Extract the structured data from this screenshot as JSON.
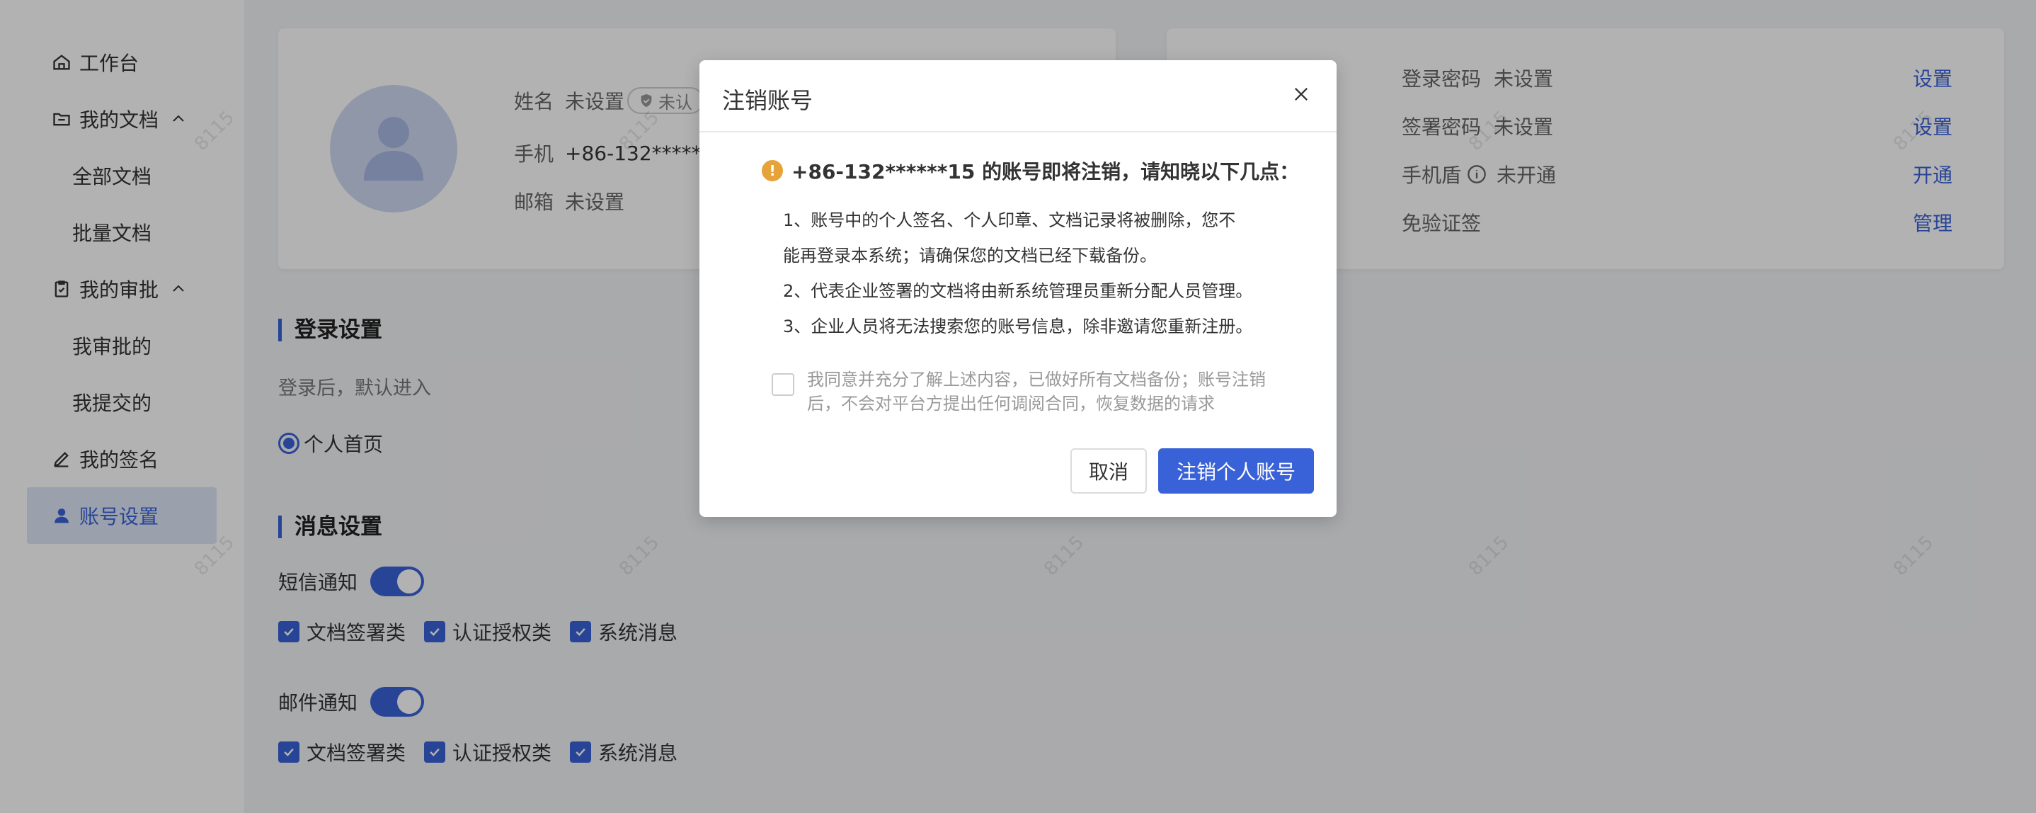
{
  "colors": {
    "accent": "#3a62d8",
    "warning": "#e5a33a",
    "overlay": "rgba(0,0,0,0.30)"
  },
  "sidebar": {
    "items": [
      {
        "label": "工作台",
        "icon": "home-icon"
      },
      {
        "label": "我的文档",
        "icon": "folder-icon",
        "expanded": true
      },
      {
        "label": "全部文档"
      },
      {
        "label": "批量文档"
      },
      {
        "label": "我的审批",
        "icon": "clipboard-icon",
        "expanded": true
      },
      {
        "label": "我审批的"
      },
      {
        "label": "我提交的"
      },
      {
        "label": "我的签名",
        "icon": "pen-icon"
      },
      {
        "label": "账号设置",
        "icon": "user-icon",
        "active": true
      }
    ]
  },
  "profile": {
    "name_label": "姓名",
    "name_value": "未设置",
    "badge": "未认",
    "phone_label": "手机",
    "phone_value": "+86-132*****",
    "email_label": "邮箱",
    "email_value": "未设置"
  },
  "security": {
    "rows": [
      {
        "label": "登录密码",
        "value": "未设置",
        "action": "设置"
      },
      {
        "label": "签署密码",
        "value": "未设置",
        "action": "设置"
      },
      {
        "label": "手机盾",
        "value": "未开通",
        "action": "开通"
      },
      {
        "label": "免验证签",
        "value": "",
        "action": "管理"
      }
    ]
  },
  "login_settings": {
    "title": "登录设置",
    "desc": "登录后，默认进入",
    "option": "个人首页"
  },
  "message_settings": {
    "title": "消息设置",
    "sms_label": "短信通知",
    "email_label": "邮件通知",
    "categories": [
      "文档签署类",
      "认证授权类",
      "系统消息"
    ]
  },
  "watermark": "8115",
  "modal": {
    "title": "注销账号",
    "warning": "+86-132******15 的账号即将注销，请知晓以下几点：",
    "rules": [
      "1、账号中的个人签名、个人印章、文档记录将被删除，您不",
      "能再登录本系统；请确保您的文档已经下载备份。",
      "2、代表企业签署的文档将由新系统管理员重新分配人员管理。",
      "3、企业人员将无法搜索您的账号信息，除非邀请您重新注册。"
    ],
    "agree_text": "我同意并充分了解上述内容，已做好所有文档备份；账号注销后，不会对平台方提出任何调阅合同，恢复数据的请求",
    "cancel_label": "取消",
    "confirm_label": "注销个人账号"
  }
}
